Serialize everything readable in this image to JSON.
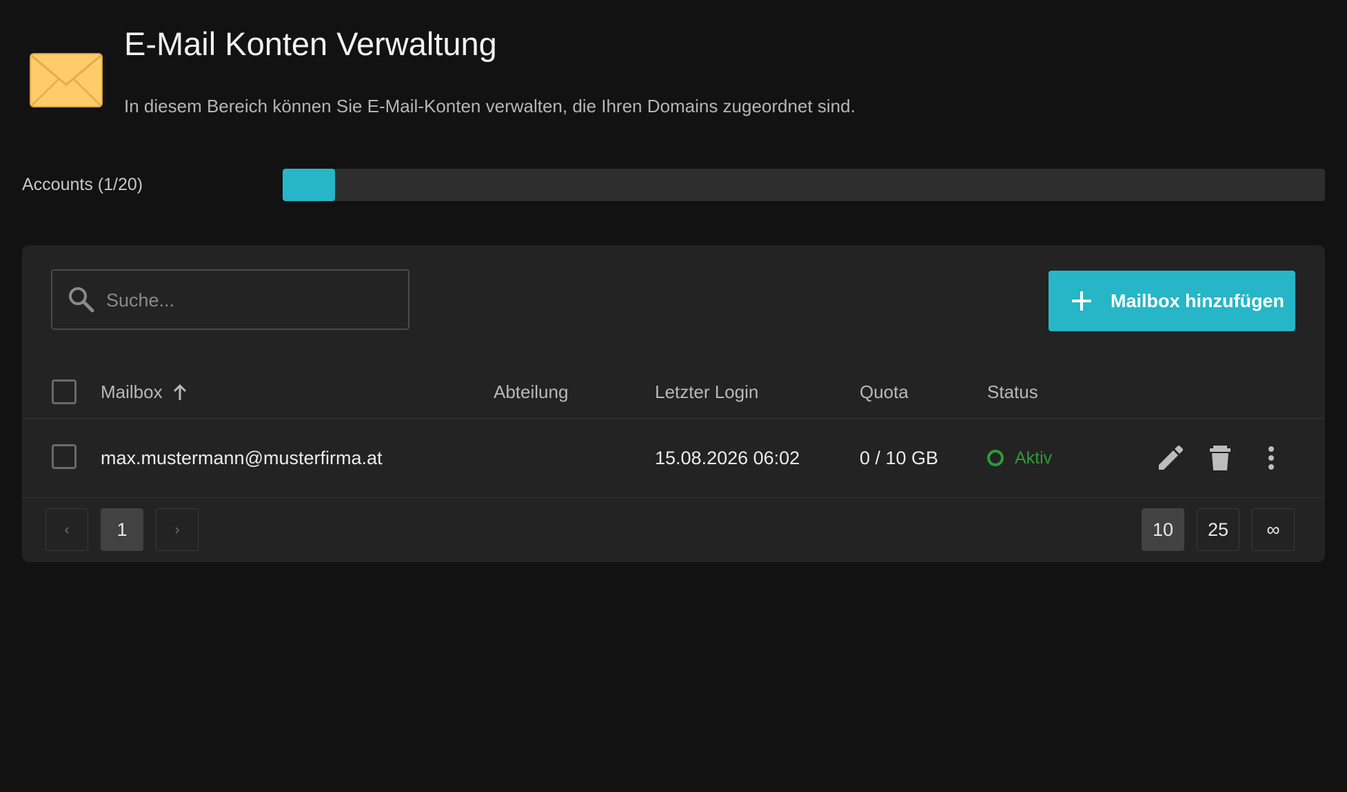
{
  "header": {
    "title": "E-Mail Konten Verwaltung",
    "subtitle": "In diesem Bereich können Sie E-Mail-Konten verwalten, die Ihren Domains zugeordnet sind.",
    "icon": "envelope-icon"
  },
  "accounts": {
    "label": "Accounts (1/20)",
    "used": 1,
    "total": 20,
    "fill_fraction": 0.05
  },
  "toolbar": {
    "search_placeholder": "Suche...",
    "add_button_label": "Mailbox hinzufügen"
  },
  "table": {
    "columns": {
      "mailbox": "Mailbox",
      "abteilung": "Abteilung",
      "letzter_login": "Letzter Login",
      "quota": "Quota",
      "status": "Status"
    },
    "sort": {
      "column": "Mailbox",
      "direction": "ascending"
    },
    "rows": [
      {
        "mailbox": "max.mustermann@musterfirma.at",
        "abteilung": "",
        "letzter_login": "15.08.2026 06:02",
        "quota": "0 / 10 GB",
        "status": "Aktiv"
      }
    ]
  },
  "pagination": {
    "prev": "‹",
    "pages": [
      "1"
    ],
    "current_page": "1",
    "next": "›",
    "page_sizes": [
      "10",
      "25",
      "∞"
    ],
    "selected_page_size": "10"
  },
  "colors": {
    "accent": "#26b6c7",
    "status_active": "#2e9a3a",
    "background": "#121212",
    "card": "#232323"
  }
}
